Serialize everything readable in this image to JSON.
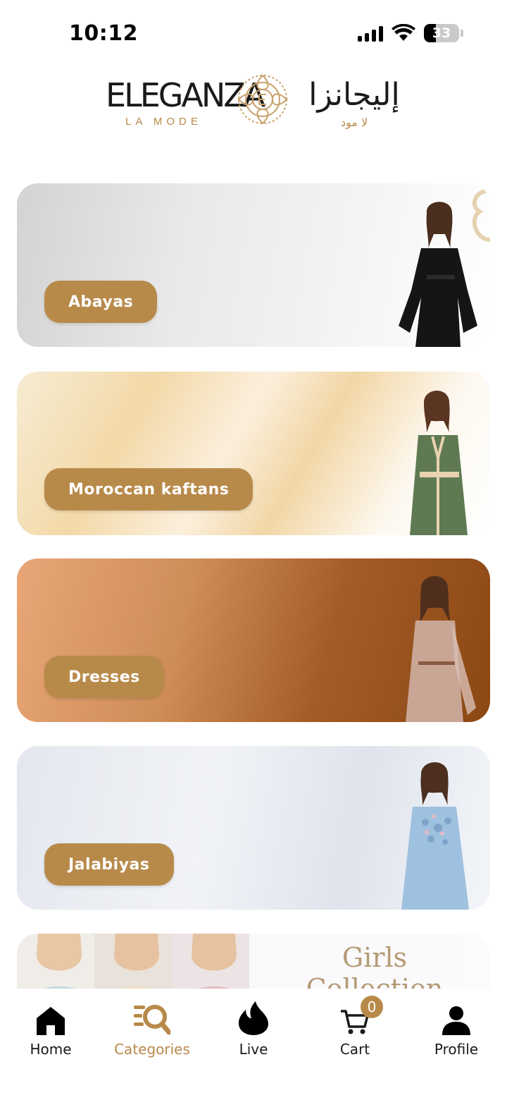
{
  "status_bar": {
    "time": "10:12",
    "battery": "33",
    "battery_level": 0.33
  },
  "logo": {
    "latin_main": "ELEGANZA",
    "latin_sub": "LA MODE",
    "arabic_main": "إليجانزا",
    "arabic_sub": "لا مود"
  },
  "categories": [
    {
      "label": "Abayas"
    },
    {
      "label": "Moroccan kaftans"
    },
    {
      "label": "Dresses"
    },
    {
      "label": "Jalabiyas"
    },
    {
      "title_line1": "Girls",
      "title_line2": "Collection"
    }
  ],
  "nav": {
    "items": [
      {
        "label": "Home",
        "icon": "home-icon"
      },
      {
        "label": "Categories",
        "icon": "categories-search-icon"
      },
      {
        "label": "Live",
        "icon": "flame-icon"
      },
      {
        "label": "Cart",
        "icon": "cart-icon"
      },
      {
        "label": "Profile",
        "icon": "profile-icon"
      }
    ],
    "active": "Categories",
    "cart_count": "0"
  },
  "colors": {
    "accent": "#b88a4a",
    "text": "#1a1a1a",
    "background": "#ffffff"
  }
}
